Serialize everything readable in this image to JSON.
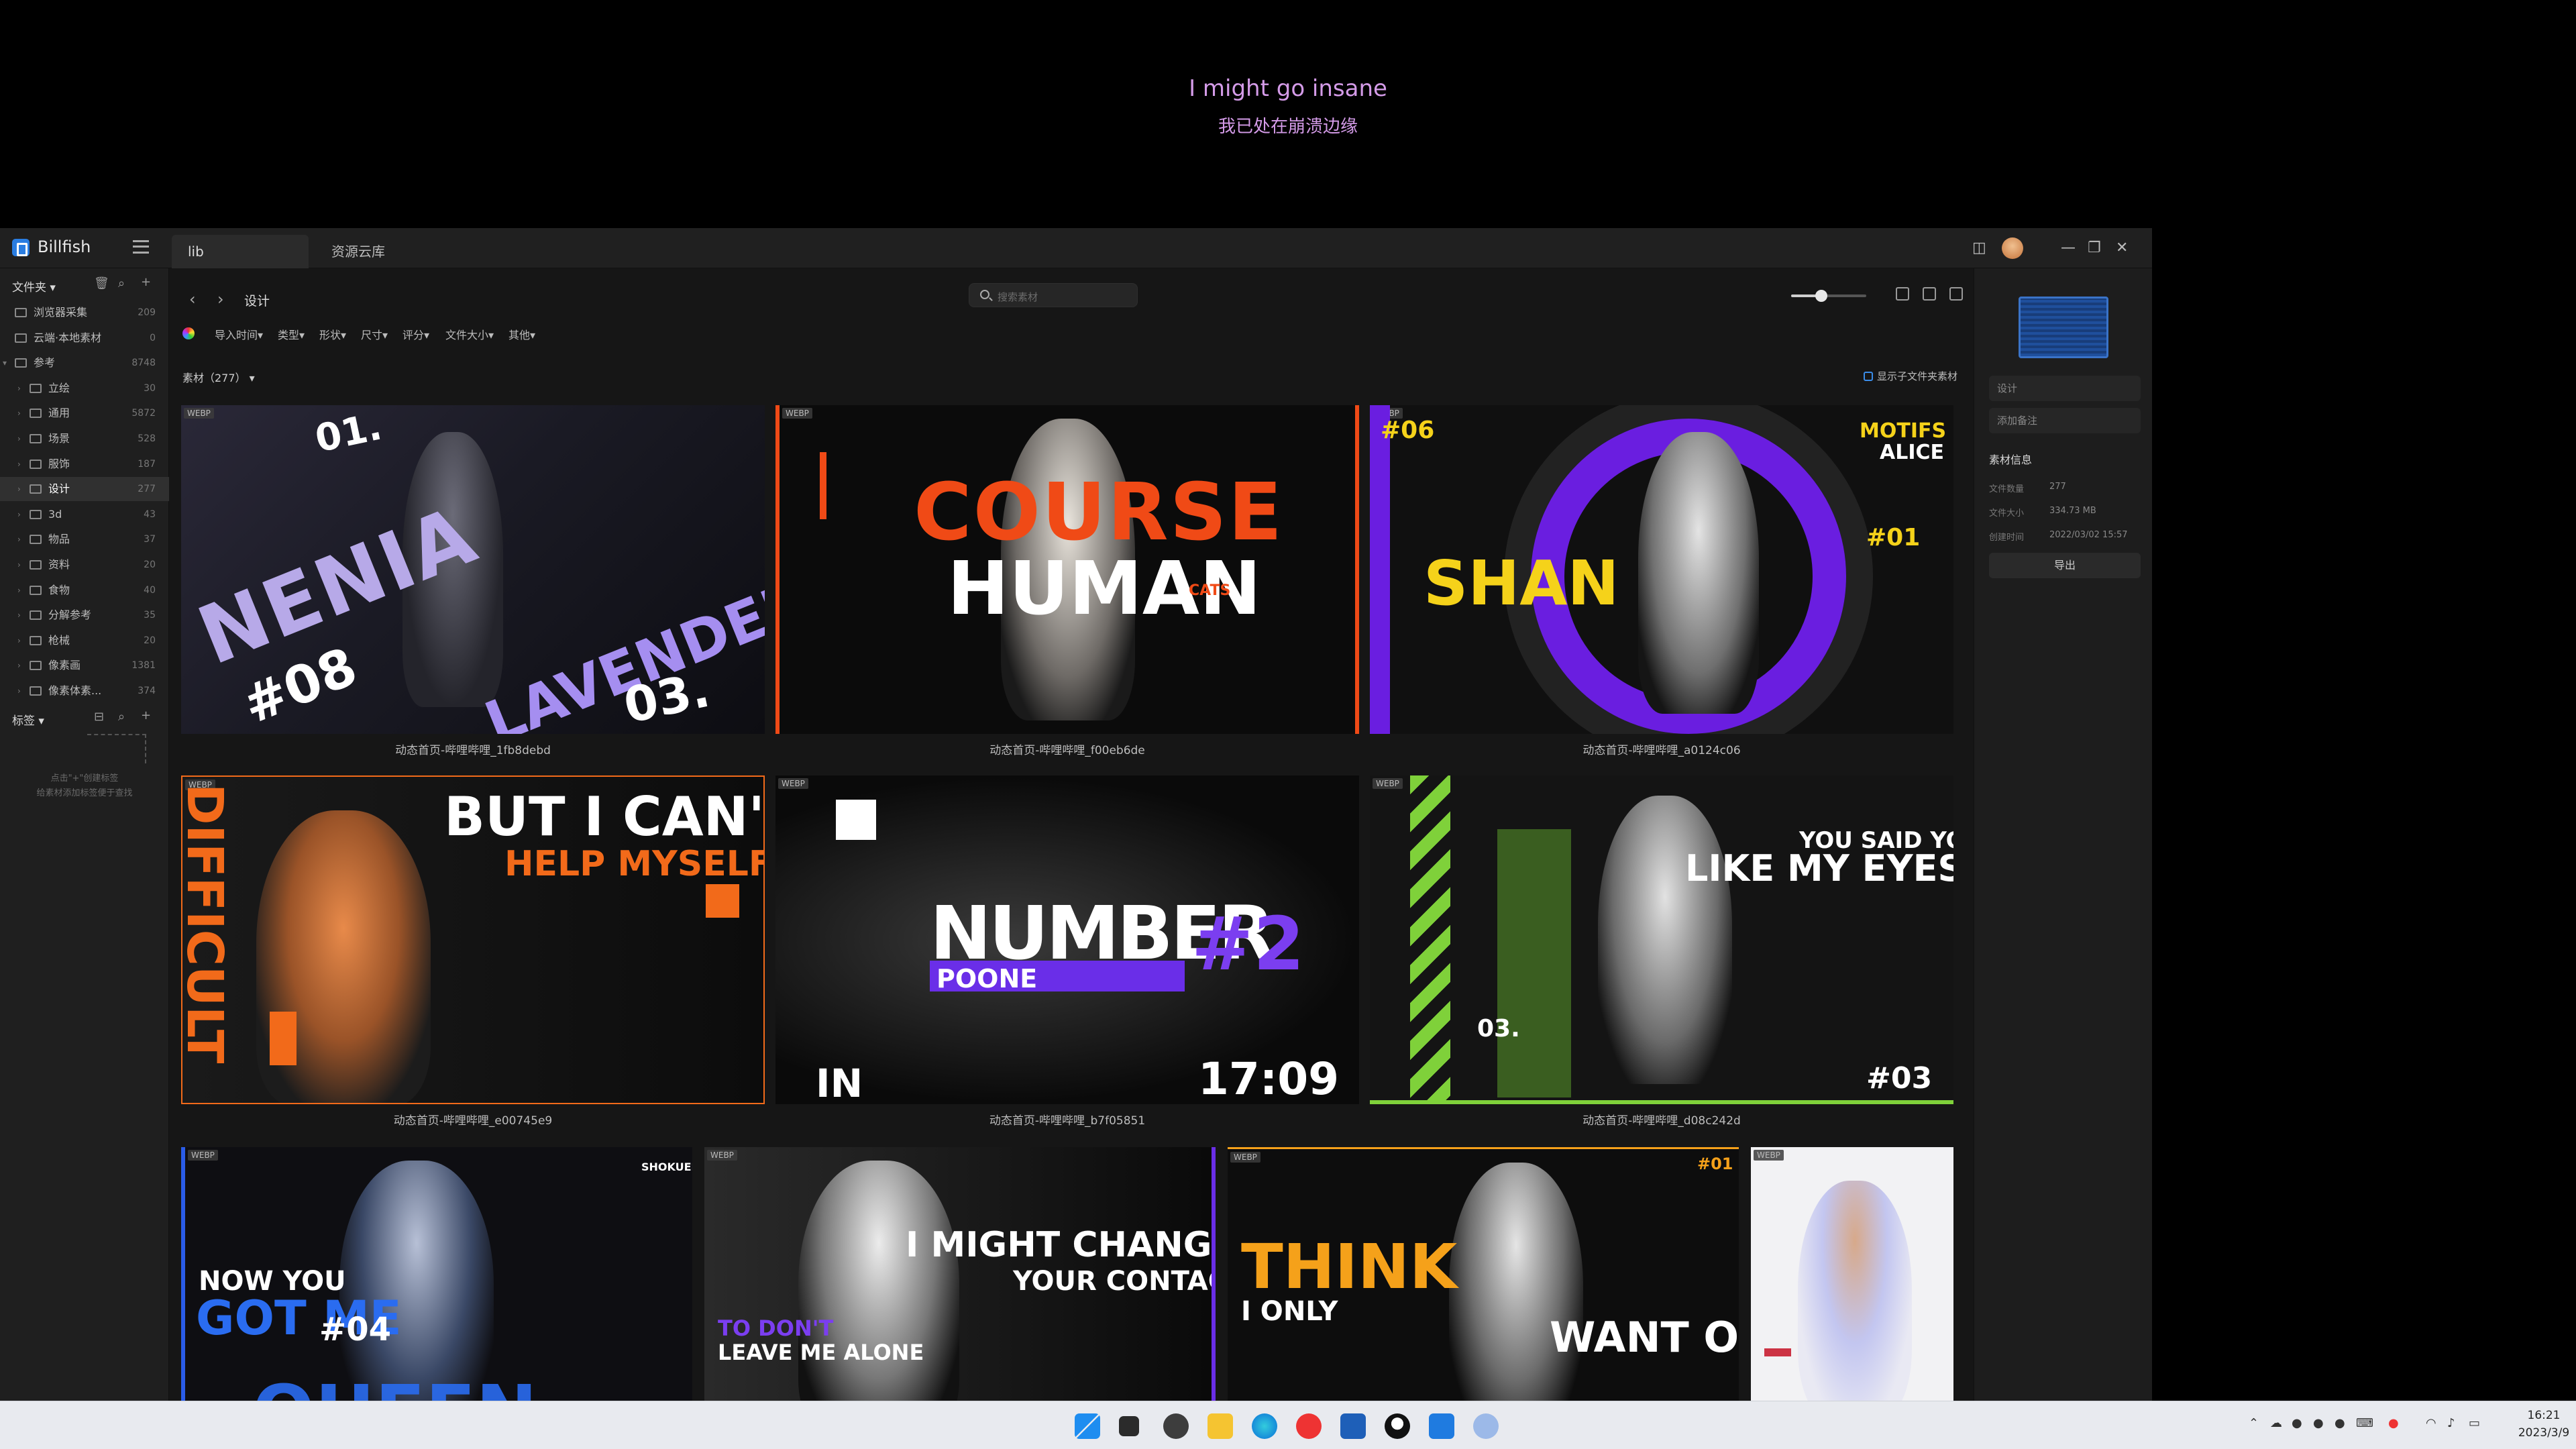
{
  "lyrics": {
    "line1": "I might go insane",
    "line2": "我已处在崩溃边缘"
  },
  "app": {
    "name": "Billfish",
    "tabs": [
      "lib",
      "资源云库"
    ],
    "breadcrumb": "设计",
    "search_placeholder": "搜索素材",
    "zoom_slider": 0.4,
    "filters": [
      "导入时间",
      "类型",
      "形状",
      "尺寸",
      "评分",
      "文件大小",
      "其他"
    ],
    "material_count": "素材（277）",
    "show_subfolder": "显示子文件夹素材",
    "colors": {
      "accent": "#2a7de1",
      "bg": "#161616",
      "sidebar": "#1f1f1f"
    }
  },
  "sidebar": {
    "folder_header": "文件夹",
    "items": [
      {
        "label": "浏览器采集",
        "count": "209"
      },
      {
        "label": "云端·本地素材",
        "count": "0"
      },
      {
        "label": "参考",
        "count": "8748"
      },
      {
        "label": "立绘",
        "count": "30"
      },
      {
        "label": "通用",
        "count": "5872"
      },
      {
        "label": "场景",
        "count": "528"
      },
      {
        "label": "服饰",
        "count": "187"
      },
      {
        "label": "设计",
        "count": "277"
      },
      {
        "label": "3d",
        "count": "43"
      },
      {
        "label": "物品",
        "count": "37"
      },
      {
        "label": "资料",
        "count": "20"
      },
      {
        "label": "食物",
        "count": "40"
      },
      {
        "label": "分解参考",
        "count": "35"
      },
      {
        "label": "枪械",
        "count": "20"
      },
      {
        "label": "像素画",
        "count": "1381"
      },
      {
        "label": "像素体素...",
        "count": "374"
      }
    ],
    "tag_header": "标签",
    "tag_empty_1": "点击\"+\"创建标签",
    "tag_empty_2": "给素材添加标签便于查找"
  },
  "gallery": {
    "row1": [
      {
        "caption": "动态首页-哔哩哔哩_1fb8debd",
        "badge": "WEBP",
        "t1": "NENIA",
        "t2": "LAVENDER",
        "t3": "#08",
        "t4": "01.",
        "t5": "03."
      },
      {
        "caption": "动态首页-哔哩哔哩_f00eb6de",
        "badge": "WEBP",
        "t1": "COURSE",
        "t2": "HUMAN",
        "t3": "CATS"
      },
      {
        "caption": "动态首页-哔哩哔哩_a0124c06",
        "badge": "WEBP",
        "t1": "SHAN",
        "t2": "MOTIFS",
        "t3": "ALICE",
        "t4": "#06",
        "t5": "#01"
      }
    ],
    "row2": [
      {
        "caption": "动态首页-哔哩哔哩_e00745e9",
        "badge": "WEBP",
        "t1": "BUT I CAN'T",
        "t2": "HELP MYSELF",
        "t3": "DIFFICULT"
      },
      {
        "caption": "动态首页-哔哩哔哩_b7f05851",
        "badge": "WEBP",
        "t1": "NUMBER",
        "t2": "POONE",
        "t3": "#2",
        "t4": "17:09",
        "t5": "IN"
      },
      {
        "caption": "动态首页-哔哩哔哩_d08c242d",
        "badge": "WEBP",
        "t1": "YOU SAID YOU",
        "t2": "LIKE MY EYES",
        "t3": "#03",
        "t4": "03."
      }
    ],
    "row3": [
      {
        "badge": "WEBP",
        "t1": "NOW YOU",
        "t2": "GOT ME",
        "t3": "#04",
        "t4": "QUEEN",
        "t5": "SHOKUEN"
      },
      {
        "badge": "WEBP",
        "t1": "I MIGHT CHANGE",
        "t2": "YOUR CONTACT",
        "t3": "TO DON'T",
        "t4": "LEAVE ME ALONE"
      },
      {
        "badge": "WEBP",
        "t1": "THINK",
        "t2": "I ONLY",
        "t3": "WANT ONE",
        "t4": "#01"
      },
      {
        "badge": "WEBP"
      }
    ]
  },
  "right_panel": {
    "name_value": "设计",
    "note_placeholder": "添加备注",
    "info_title": "素材信息",
    "info": [
      {
        "key": "文件数量",
        "value": "277"
      },
      {
        "key": "文件大小",
        "value": "334.73 MB"
      },
      {
        "key": "创建时间",
        "value": "2022/03/02 15:57"
      }
    ],
    "export_label": "导出"
  },
  "taskbar": {
    "time": "16:21",
    "date": "2023/3/9"
  }
}
